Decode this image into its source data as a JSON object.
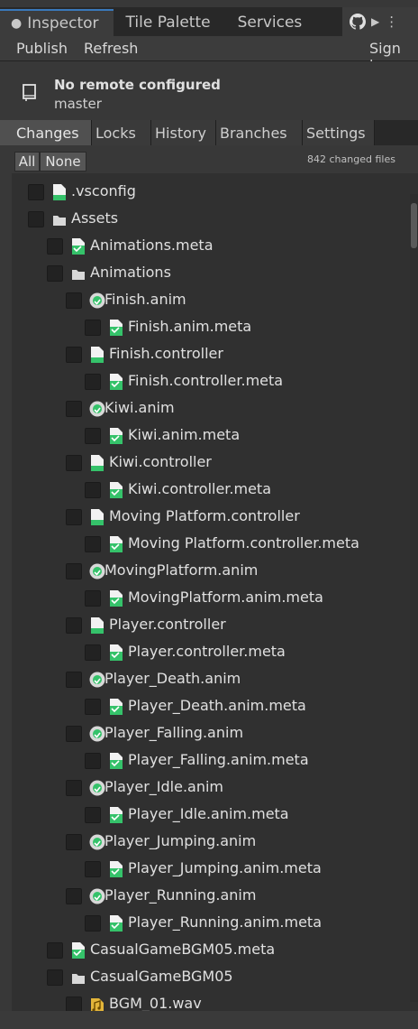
{
  "editor_tabs": {
    "inspector": "Inspector",
    "tile_palette": "Tile Palette",
    "services": "Services"
  },
  "toolbar": {
    "publish": "Publish",
    "refresh": "Refresh",
    "sign_in": "Sign in"
  },
  "repo": {
    "title": "No remote configured",
    "branch": "master"
  },
  "subtabs": [
    "Changes",
    "Locks",
    "History",
    "Branches",
    "Settings"
  ],
  "filter": {
    "all": "All",
    "none": "None",
    "changed_count": "842 changed files"
  },
  "tree": [
    {
      "label": ".vsconfig",
      "icon": "file",
      "depth": 1
    },
    {
      "label": "Assets",
      "icon": "folder",
      "depth": 1
    },
    {
      "label": "Animations.meta",
      "icon": "meta",
      "depth": 2
    },
    {
      "label": "Animations",
      "icon": "folder",
      "depth": 2
    },
    {
      "label": "Finish.anim",
      "icon": "anim",
      "depth": 3
    },
    {
      "label": "Finish.anim.meta",
      "icon": "meta",
      "depth": 4
    },
    {
      "label": "Finish.controller",
      "icon": "file",
      "depth": 3
    },
    {
      "label": "Finish.controller.meta",
      "icon": "meta",
      "depth": 4
    },
    {
      "label": "Kiwi.anim",
      "icon": "anim",
      "depth": 3
    },
    {
      "label": "Kiwi.anim.meta",
      "icon": "meta",
      "depth": 4
    },
    {
      "label": "Kiwi.controller",
      "icon": "file",
      "depth": 3
    },
    {
      "label": "Kiwi.controller.meta",
      "icon": "meta",
      "depth": 4
    },
    {
      "label": "Moving Platform.controller",
      "icon": "file",
      "depth": 3
    },
    {
      "label": "Moving Platform.controller.meta",
      "icon": "meta",
      "depth": 4
    },
    {
      "label": "MovingPlatform.anim",
      "icon": "anim",
      "depth": 3
    },
    {
      "label": "MovingPlatform.anim.meta",
      "icon": "meta",
      "depth": 4
    },
    {
      "label": "Player.controller",
      "icon": "file",
      "depth": 3
    },
    {
      "label": "Player.controller.meta",
      "icon": "meta",
      "depth": 4
    },
    {
      "label": "Player_Death.anim",
      "icon": "anim",
      "depth": 3
    },
    {
      "label": "Player_Death.anim.meta",
      "icon": "meta",
      "depth": 4
    },
    {
      "label": "Player_Falling.anim",
      "icon": "anim",
      "depth": 3
    },
    {
      "label": "Player_Falling.anim.meta",
      "icon": "meta",
      "depth": 4
    },
    {
      "label": "Player_Idle.anim",
      "icon": "anim",
      "depth": 3
    },
    {
      "label": "Player_Idle.anim.meta",
      "icon": "meta",
      "depth": 4
    },
    {
      "label": "Player_Jumping.anim",
      "icon": "anim",
      "depth": 3
    },
    {
      "label": "Player_Jumping.anim.meta",
      "icon": "meta",
      "depth": 4
    },
    {
      "label": "Player_Running.anim",
      "icon": "anim",
      "depth": 3
    },
    {
      "label": "Player_Running.anim.meta",
      "icon": "meta",
      "depth": 4
    },
    {
      "label": "CasualGameBGM05.meta",
      "icon": "meta",
      "depth": 2
    },
    {
      "label": "CasualGameBGM05",
      "icon": "folder",
      "depth": 2
    },
    {
      "label": "BGM_01.wav",
      "icon": "audio",
      "depth": 3
    }
  ],
  "colors": {
    "accent": "#3a79bb",
    "file_green": "#35c26a",
    "audio_yellow": "#e3b53a"
  }
}
